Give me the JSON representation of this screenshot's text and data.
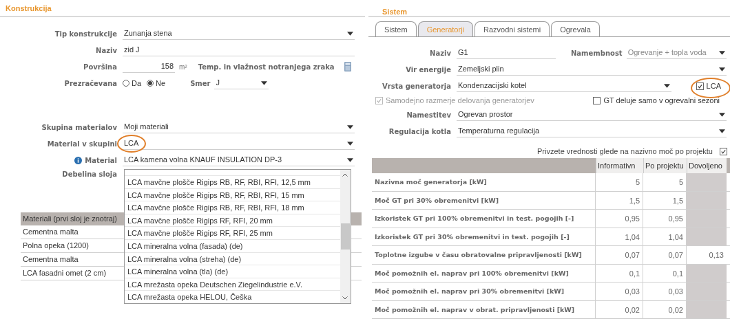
{
  "konstrukcija": {
    "title": "Konstrukcija",
    "tip": {
      "label": "Tip konstrukcije",
      "value": "Zunanja stena"
    },
    "naziv": {
      "label": "Naziv",
      "value": "zid J"
    },
    "povrsina": {
      "label": "Površina",
      "value": "158",
      "unit": "m²",
      "link": "Temp. in vlažnost notranjega zraka"
    },
    "prezracevana": {
      "label": "Prezračevana",
      "options": [
        {
          "label": "Da",
          "selected": false
        },
        {
          "label": "Ne",
          "selected": true
        }
      ],
      "smer_label": "Smer",
      "smer_value": "J"
    },
    "skupina": {
      "label": "Skupina materialov",
      "value": "Moji materiali"
    },
    "material_v_skupini": {
      "label": "Material v skupini",
      "value": "LCA",
      "highlighted": true
    },
    "material": {
      "label": "Material",
      "value": "LCA kamena volna KNAUF INSULATION DP-3"
    },
    "debelina": {
      "label": "Debelina sloja"
    },
    "dropdown": {
      "options": [
        "LCA mavčne plošče Rigips RB, RF, RBI, RFI, 12,5 mm",
        "LCA mavčne plošče Rigips RB, RF, RBI, RFI, 15 mm",
        "LCA mavčne plošče Rigips RB, RF, RBI, RFI, 18 mm",
        "LCA mavčne plošče Rigips RF, RFI, 20 mm",
        "LCA mavčne plošče Rigips RF, RFI, 25 mm",
        "LCA mineralna volna (fasada) (de)",
        "LCA mineralna volna (streha) (de)",
        "LCA mineralna volna (tla) (de)",
        "LCA mrežasta opeka Deutschen Ziegelindustrie e.V.",
        "LCA mrežasta opeka HELOU, Češka"
      ]
    },
    "table": {
      "header": "Materiali (prvi sloj je znotraj)",
      "rows": [
        "Cementna malta",
        "Polna opeka (1200)",
        "Cementna malta",
        "LCA fasadni omet (2 cm)"
      ]
    }
  },
  "sistem": {
    "title": "Sistem",
    "tabs": [
      {
        "label": "Sistem",
        "selected": false
      },
      {
        "label": "Generatorji",
        "selected": true
      },
      {
        "label": "Razvodni sistemi",
        "selected": false
      },
      {
        "label": "Ogrevala",
        "selected": false
      }
    ],
    "naziv": {
      "label": "Naziv",
      "value": "G1"
    },
    "namembnost": {
      "label": "Namembnost",
      "value": "Ogrevanje + topla voda"
    },
    "vir": {
      "label": "Vir energije",
      "value": "Zemeljski plin"
    },
    "vrsta": {
      "label": "Vrsta generatorja",
      "value": "Kondenzacijski kotel"
    },
    "lca": {
      "label": "LCA",
      "checked": true,
      "highlighted": true
    },
    "samodejno": {
      "label": "Samodejno razmerje delovanja generatorjev",
      "checked": true,
      "disabled": true
    },
    "gt_sezona": {
      "label": "GT deluje samo v ogrevalni sezoni",
      "checked": false
    },
    "namestitev": {
      "label": "Namestitev",
      "value": "Ogrevan prostor"
    },
    "regulacija": {
      "label": "Regulacija kotla",
      "value": "Temperaturna regulacija"
    },
    "privzete": {
      "label": "Privzete vrednosti glede na nazivno moč po projektu",
      "checked": true
    },
    "table": {
      "columns": [
        "Informativn",
        "Po projektu",
        "Dovoljeno"
      ],
      "rows": [
        {
          "label": "Nazivna moč generatorja [kW]",
          "informativno": "5",
          "po_projektu": "5",
          "dovoljeno": null
        },
        {
          "label": "Moč GT pri 30% obremenitvi [kW]",
          "informativno": "1,5",
          "po_projektu": "1,5",
          "dovoljeno": null
        },
        {
          "label": "Izkoristek GT pri 100% obremenitvi in test. pogojih [-]",
          "informativno": "0,95",
          "po_projektu": "0,95",
          "dovoljeno": null
        },
        {
          "label": "Izkoristek GT pri 30% obremenitvi in test. pogojih [-]",
          "informativno": "1,04",
          "po_projektu": "1,04",
          "dovoljeno": null
        },
        {
          "label": "Toplotne izgube v času obratovalne pripravljenosti [kW]",
          "informativno": "0,07",
          "po_projektu": "0,07",
          "dovoljeno": "0,13"
        },
        {
          "label": "Moč pomožnih el. naprav pri 100% obremenitvi [kW]",
          "informativno": "0,1",
          "po_projektu": "0,1",
          "dovoljeno": null
        },
        {
          "label": "Moč pomožnih el. naprav pri 30% obremenitvi [kW]",
          "informativno": "0,03",
          "po_projektu": "0,03",
          "dovoljeno": null
        },
        {
          "label": "Moč pomožnih el. naprav v obrat. pripravljenosti [kW]",
          "informativno": "0,02",
          "po_projektu": "0,02",
          "dovoljeno": null
        }
      ]
    }
  }
}
